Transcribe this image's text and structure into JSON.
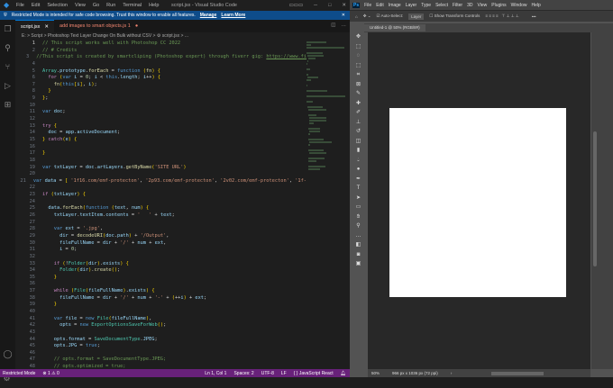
{
  "vscode": {
    "title": "script.jsx - Visual Studio Code",
    "menu": [
      "File",
      "Edit",
      "Selection",
      "View",
      "Go",
      "Run",
      "Terminal",
      "Help"
    ],
    "restricted": {
      "text": "Restricted Mode is intended for safe code browsing. Trust this window to enable all features.",
      "manage": "Manage",
      "learn_more": "Learn More"
    },
    "tabs": [
      {
        "label": "script.jsx",
        "active": true
      },
      {
        "label": "add images to smart objects.js 1",
        "active": false
      }
    ],
    "breadcrumb": "E: > Script > Photoshop Text Layer Change On Bulk without CSV > ⚙ script.jsx > ...",
    "code_lines": [
      "// This script works well with Photoshop CC 2022",
      "// # Credits",
      "//This script is created by smartcliping (Photoshop expert) through fiverr gig: https://www.fi",
      "",
      "Array.prototype.forEach = function (fn) {",
      "  for (var i = 0; i < this.length; i++) {",
      "    fn(this[i], i);",
      "  }",
      "};",
      "",
      "var doc;",
      "",
      "try {",
      "  doc = app.activeDocument;",
      "} catch(e) {",
      "",
      "}",
      "",
      "var txtLayer = doc.artLayers.getByName('SITE URL')",
      "",
      "var data = [ '1f16.com/emf-protecton', '2p93.com/emf-protecton', '2v02.com/emf-protecton', '1f-",
      "",
      "if (txtLayer) {",
      "",
      "  data.forEach(function (text, num) {",
      "    txtLayer.textItem.contents = '   ' + text;",
      "",
      "    var ext = '.jpg',",
      "      dir = decodeURI(doc.path) + '/Output',",
      "      fileFullName = dir + '/' + num + ext,",
      "      i = 0;",
      "",
      "    if (!Folder(dir).exists) {",
      "      Folder(dir).create();",
      "    }",
      "",
      "    while (File(fileFullName).exists) {",
      "      fileFullName = dir + '/' + num + '-' + (++i) + ext;",
      "    }",
      "",
      "    var file = new File(fileFullName),",
      "      opts = new ExportOptionsSaveForWeb();",
      "",
      "    opts.format = SaveDocumentType.JPEG;",
      "    opts.JPG = true;",
      "",
      "    // opts.format = SaveDocumentType.JPEG;",
      "    // opts.optimized = true;"
    ],
    "status": {
      "mode": "Restricted Mode",
      "problems": "⊗ 1 ⚠ 0",
      "position": "Ln 1, Col 1",
      "spaces": "Spaces: 2",
      "encoding": "UTF-8",
      "eol": "LF",
      "language": "{ } JavaScript React"
    }
  },
  "photoshop": {
    "logo": "Ps",
    "menu": [
      "File",
      "Edit",
      "Image",
      "Layer",
      "Type",
      "Select",
      "Filter",
      "3D",
      "View",
      "Plugins",
      "Window",
      "Help"
    ],
    "options": {
      "auto_select": "Auto-Select:",
      "layer": "Layer",
      "transform": "Show Transform Controls"
    },
    "doc_tab": "Untitled-1 @ 50% (RGB/8#)",
    "status": {
      "zoom": "50%",
      "size": "966 px x 1036 px (72 ppi)"
    }
  }
}
